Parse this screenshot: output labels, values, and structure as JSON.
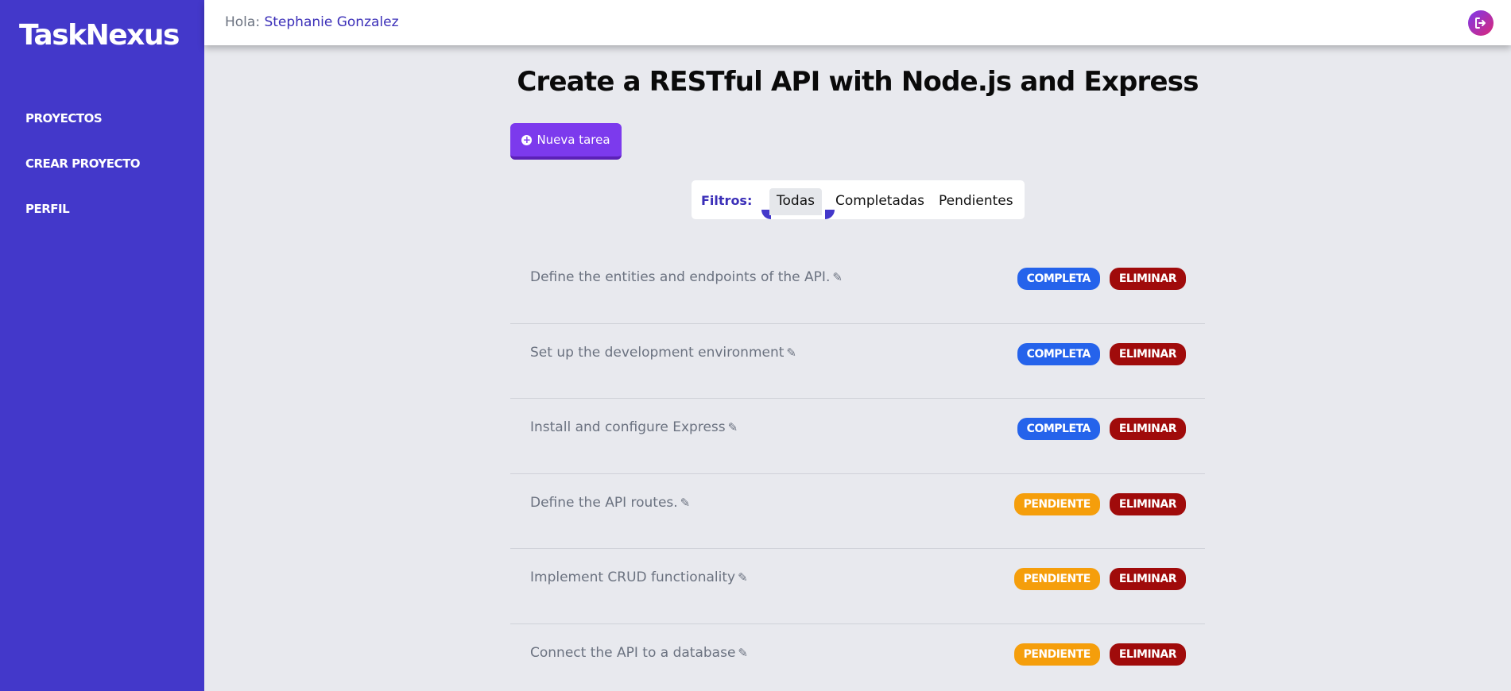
{
  "app": {
    "name": "TaskNexus"
  },
  "sidebar": {
    "items": [
      {
        "label": "PROYECTOS"
      },
      {
        "label": "CREAR PROYECTO"
      },
      {
        "label": "PERFIL"
      }
    ]
  },
  "header": {
    "greeting": "Hola:",
    "user_name": "Stephanie Gonzalez",
    "logout_icon": "logout-icon"
  },
  "project": {
    "title": "Create a RESTful API with Node.js and Express"
  },
  "toolbar": {
    "new_task_label": "Nueva tarea"
  },
  "filters": {
    "label": "Filtros:",
    "options": [
      "Todas",
      "Completadas",
      "Pendientes"
    ],
    "selected": "Todas"
  },
  "tasks": [
    {
      "text": "Define the entities and endpoints of the API.",
      "status": "COMPLETA",
      "delete": "ELIMINAR"
    },
    {
      "text": "Set up the development environment",
      "status": "COMPLETA",
      "delete": "ELIMINAR"
    },
    {
      "text": "Install and configure Express",
      "status": "COMPLETA",
      "delete": "ELIMINAR"
    },
    {
      "text": "Define the API routes.",
      "status": "PENDIENTE",
      "delete": "ELIMINAR"
    },
    {
      "text": "Implement CRUD functionality",
      "status": "PENDIENTE",
      "delete": "ELIMINAR"
    },
    {
      "text": "Connect the API to a database",
      "status": "PENDIENTE",
      "delete": "ELIMINAR"
    }
  ],
  "colors": {
    "sidebar": "#4338ca",
    "complete": "#2563eb",
    "pending": "#f59e0b",
    "delete": "#a00b0b",
    "primary_button": "#7c3aed"
  }
}
